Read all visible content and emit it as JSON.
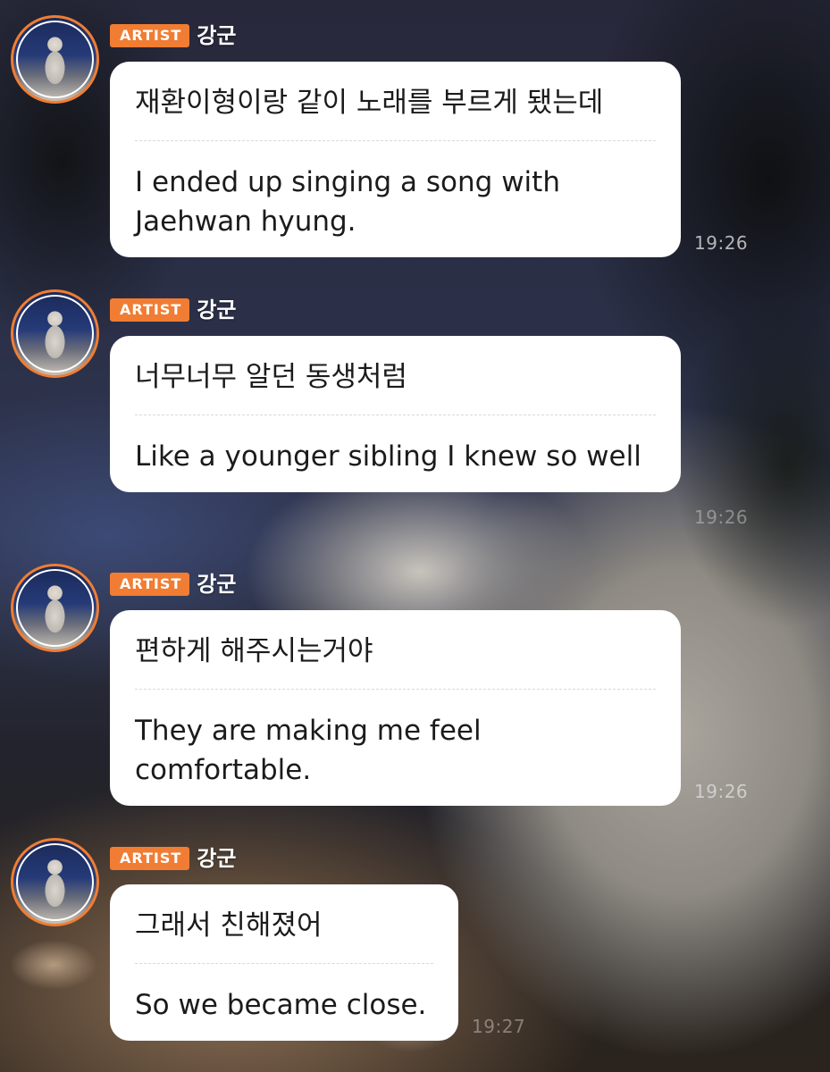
{
  "messages": [
    {
      "badge": "ARTIST",
      "sender": "강군",
      "korean": "재환이형이랑 같이 노래를 부르게 됐는데",
      "english": "I ended up singing a song with Jaehwan hyung.",
      "time": "19:26"
    },
    {
      "badge": "ARTIST",
      "sender": "강군",
      "korean": "너무너무 알던 동생처럼",
      "english": "Like a younger sibling I knew so well",
      "time": "19:26"
    },
    {
      "badge": "ARTIST",
      "sender": "강군",
      "korean": "편하게 해주시는거야",
      "english": "They are making me feel comfortable.",
      "time": "19:26"
    },
    {
      "badge": "ARTIST",
      "sender": "강군",
      "korean": "그래서 친해졌어",
      "english": "So we became close.",
      "time": "19:27"
    }
  ],
  "colors": {
    "artist_badge": "#f07d33",
    "avatar_ring": "#f07d33",
    "bubble": "#ffffff",
    "text": "#1b1b1b"
  },
  "icons": {
    "avatar": "profile-photo"
  }
}
